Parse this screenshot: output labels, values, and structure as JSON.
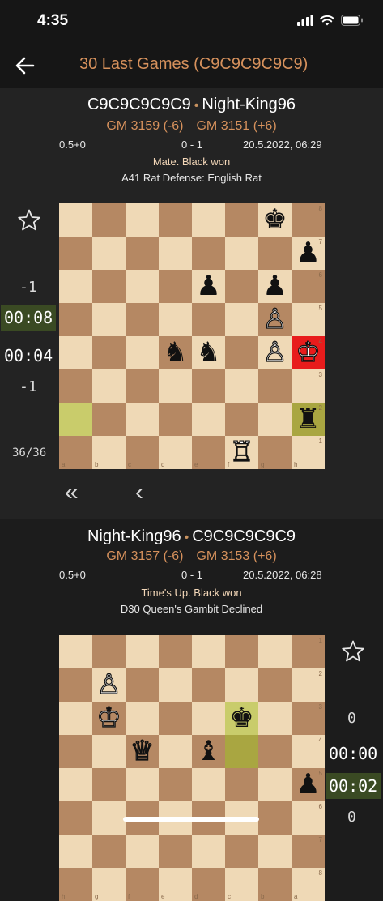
{
  "status": {
    "time": "4:35"
  },
  "nav": {
    "title": "30 Last Games (C9C9C9C9C9)"
  },
  "games": [
    {
      "white_player": "C9C9C9C9C9",
      "black_player": "Night-King96",
      "white_rating": "GM 3159 (-6)",
      "black_rating": "GM 3151 (+6)",
      "time_control": "0.5+0",
      "score": "0 - 1",
      "date": "20.5.2022, 06:29",
      "result": "Mate. Black won",
      "opening": "A41 Rat Defense: English Rat",
      "diff_top": "-1",
      "clock_top": "00:08",
      "clock_bottom": "00:04",
      "diff_bottom": "-1",
      "move_counter": "36/36",
      "nav_first": "«",
      "nav_prev": "‹",
      "ranks": [
        "8",
        "7",
        "6",
        "5",
        "4",
        "3",
        "2",
        "1"
      ],
      "files": [
        "a",
        "b",
        "c",
        "d",
        "e",
        "f",
        "g",
        "h"
      ],
      "pieces": {
        "g8": "♚",
        "h7": "♟",
        "e6": "♟",
        "g6": "♟",
        "g5": "♙",
        "d4": "♞",
        "e4": "♞",
        "g4": "♙",
        "h4": "♔",
        "h2": "♜",
        "f1": "♖"
      },
      "highlights": {
        "a2": "light",
        "h2": "dark"
      },
      "check_square": "h4"
    },
    {
      "white_player": "Night-King96",
      "black_player": "C9C9C9C9C9",
      "white_rating": "GM 3157 (-6)",
      "black_rating": "GM 3153 (+6)",
      "time_control": "0.5+0",
      "score": "0 - 1",
      "date": "20.5.2022, 06:28",
      "result": "Time's Up. Black won",
      "opening": "D30 Queen's Gambit Declined",
      "diff_top": "0",
      "clock_top": "00:00",
      "clock_bottom": "00:02",
      "diff_bottom": "0",
      "ranks": [
        "1",
        "2",
        "3",
        "4",
        "5",
        "6",
        "7",
        "8"
      ],
      "files": [
        "h",
        "g",
        "f",
        "e",
        "d",
        "c",
        "b",
        "a"
      ],
      "pieces": {
        "g2": "♙",
        "g3": "♔",
        "c3": "♚",
        "f4": "♕",
        "d4": "♝",
        "a5": "♟"
      },
      "highlights": {
        "c3": "light",
        "c4": "dark"
      }
    }
  ]
}
